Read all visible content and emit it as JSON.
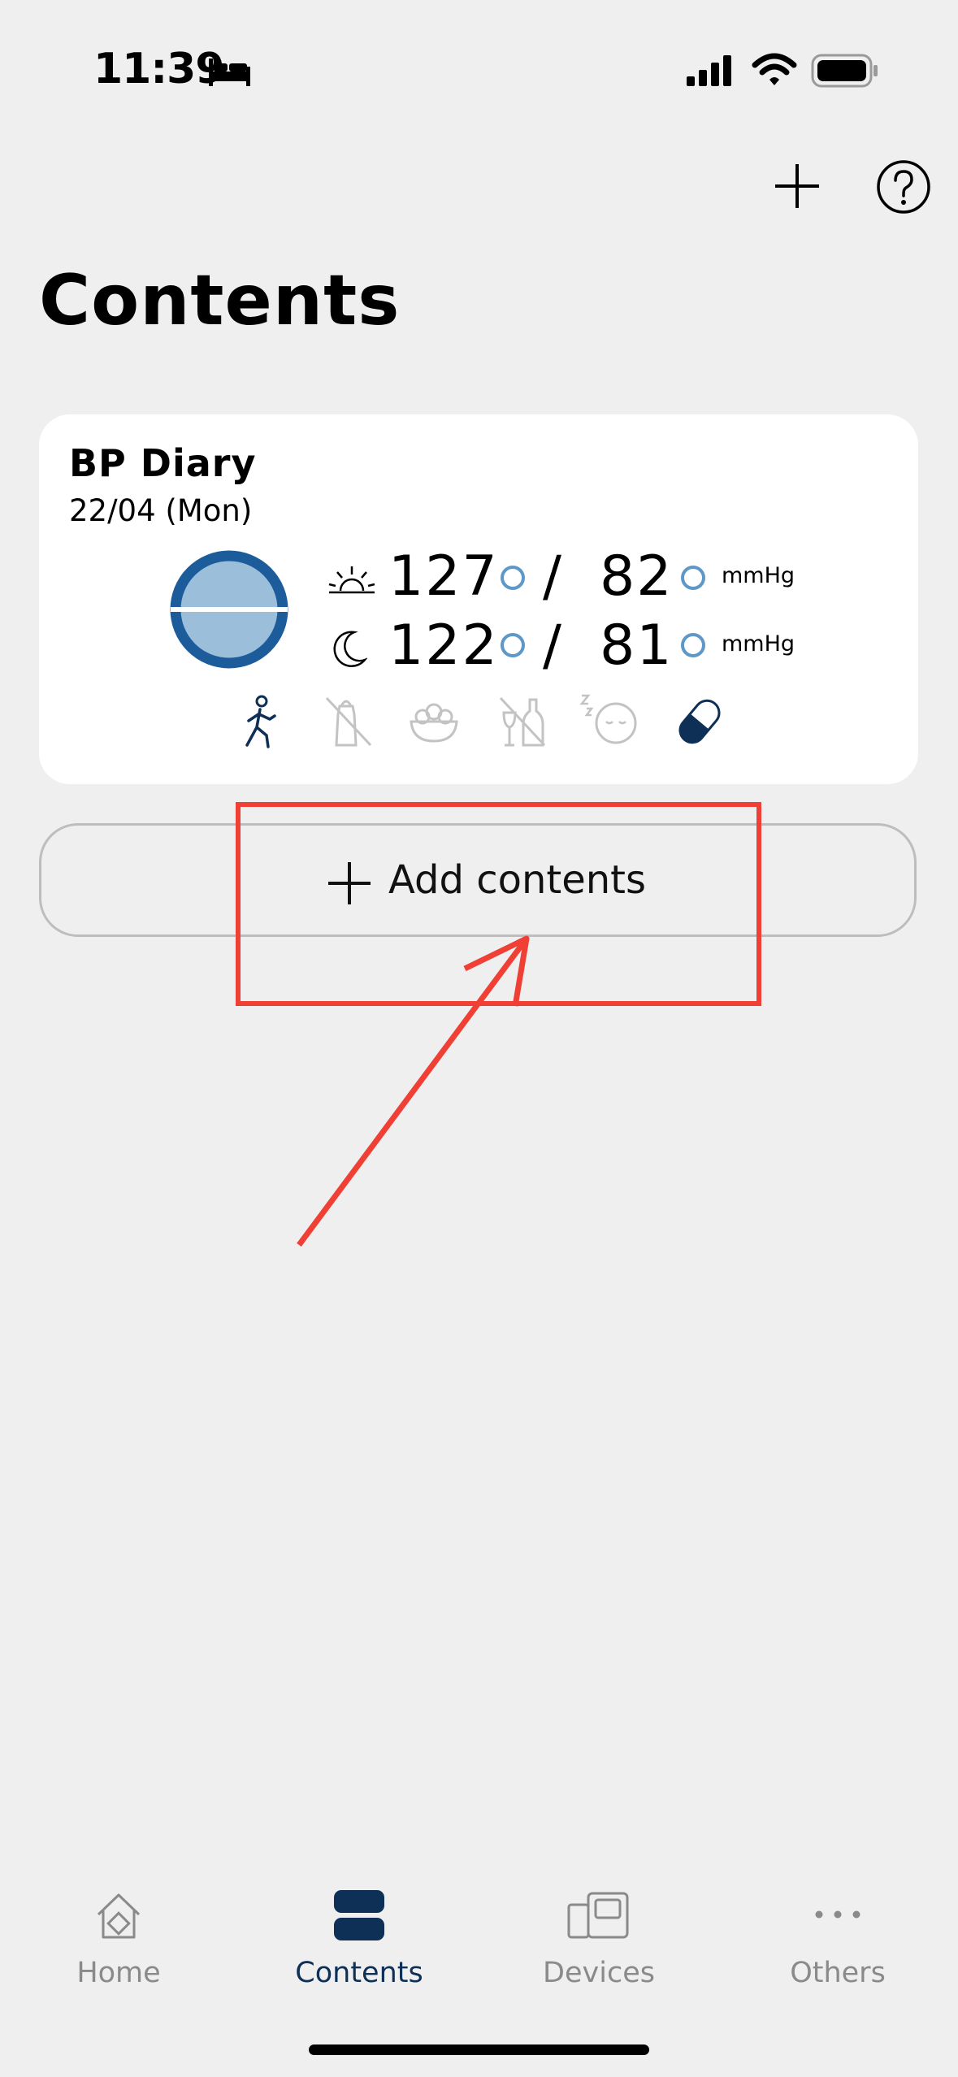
{
  "status_bar": {
    "time": "11:39"
  },
  "header": {
    "title": "Contents"
  },
  "card": {
    "title": "BP Diary",
    "date": "22/04 (Mon)",
    "morning": {
      "systolic": "127",
      "separator": "/",
      "diastolic": "82",
      "unit": "mmHg"
    },
    "evening": {
      "systolic": "122",
      "separator": "/",
      "diastolic": "81",
      "unit": "mmHg"
    },
    "lifestyle_icons": [
      "exercise-icon",
      "salt-icon",
      "vegetables-icon",
      "alcohol-icon",
      "sleep-icon",
      "medication-icon"
    ]
  },
  "add_button": {
    "label": "Add contents"
  },
  "tabs": [
    {
      "label": "Home",
      "icon": "home-icon",
      "active": false
    },
    {
      "label": "Contents",
      "icon": "contents-icon",
      "active": true
    },
    {
      "label": "Devices",
      "icon": "devices-icon",
      "active": false
    },
    {
      "label": "Others",
      "icon": "more-icon",
      "active": false
    }
  ],
  "colors": {
    "background": "#efeff0",
    "accent": "#0e2f56",
    "circle_ring": "#1c5c9a",
    "circle_fill": "#9bbfdb",
    "annotation": "#f04035"
  }
}
